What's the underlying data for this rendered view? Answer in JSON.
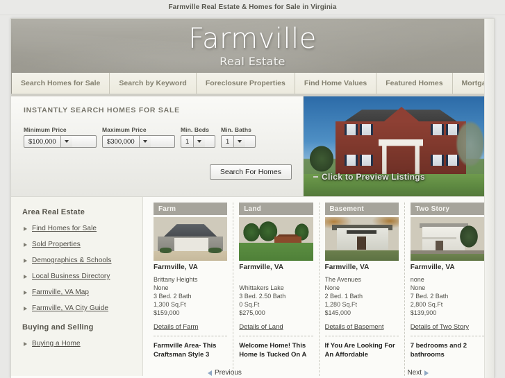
{
  "browser": {
    "page_title": "Farmville Real Estate & Homes for Sale in Virginia"
  },
  "header": {
    "brand_name": "Farmville",
    "brand_sub": "Real Estate"
  },
  "nav": {
    "items": [
      {
        "label": "Search Homes for Sale"
      },
      {
        "label": "Search by Keyword"
      },
      {
        "label": "Foreclosure Properties"
      },
      {
        "label": "Find Home Values"
      },
      {
        "label": "Featured Homes"
      },
      {
        "label": "Mortgage Info"
      }
    ]
  },
  "search_panel": {
    "heading": "INSTANTLY SEARCH HOMES FOR SALE",
    "min_price_label": "Minimum Price",
    "min_price_value": "$100,000",
    "max_price_label": "Maximum Price",
    "max_price_value": "$300,000",
    "min_beds_label": "Min. Beds",
    "min_beds_value": "1",
    "min_baths_label": "Min. Baths",
    "min_baths_value": "1",
    "submit_label": "Search For Homes"
  },
  "hero": {
    "caption": "Click to Preview Listings"
  },
  "sidebar": {
    "section1_title": "Area Real Estate",
    "section1_links": [
      {
        "label": "Find Homes for Sale"
      },
      {
        "label": "Sold Properties"
      },
      {
        "label": "Demographics & Schools"
      },
      {
        "label": "Local Business Directory"
      },
      {
        "label": "Farmville, VA Map"
      },
      {
        "label": "Farmville, VA City Guide"
      }
    ],
    "section2_title": "Buying and Selling",
    "section2_links": [
      {
        "label": "Buying a Home"
      }
    ]
  },
  "listings": [
    {
      "category": "Farm",
      "city": "Farmville, VA",
      "subdivision": "Brittany Heights",
      "extra": "None",
      "beds_baths": "3 Bed. 2 Bath",
      "sqft": "1,300 Sq.Ft",
      "price": "$159,000",
      "details_label": "Details of Farm",
      "description": "Farmville Area- This Craftsman Style 3"
    },
    {
      "category": "Land",
      "city": "Farmville, VA",
      "subdivision": "Whittakers Lake",
      "extra": "",
      "beds_baths": "3 Bed. 2.50 Bath",
      "sqft": "0 Sq.Ft",
      "price": "$275,000",
      "details_label": "Details of Land",
      "description": "Welcome Home! This Home Is Tucked On A"
    },
    {
      "category": "Basement",
      "city": "Farmville, VA",
      "subdivision": "The Avenues",
      "extra": "None",
      "beds_baths": "2 Bed. 1 Bath",
      "sqft": "1,280 Sq.Ft",
      "price": "$145,000",
      "details_label": "Details of Basement",
      "description": "If You Are Looking For An Affordable"
    },
    {
      "category": "Two Story",
      "city": "Farmville, VA",
      "subdivision": "none",
      "extra": "None",
      "beds_baths": "7 Bed. 2 Bath",
      "sqft": "2,800 Sq.Ft",
      "price": "$139,900",
      "details_label": "Details of Two Story",
      "description": "7 bedrooms and 2 bathrooms"
    }
  ],
  "pager": {
    "previous_label": "Previous",
    "next_label": "Next"
  },
  "colors": {
    "masthead": "#9e9c93",
    "nav_tab": "#f0efe6",
    "nav_text": "#83806f",
    "card_header": "#a6a49b",
    "page_bg": "#e8e8e6"
  }
}
